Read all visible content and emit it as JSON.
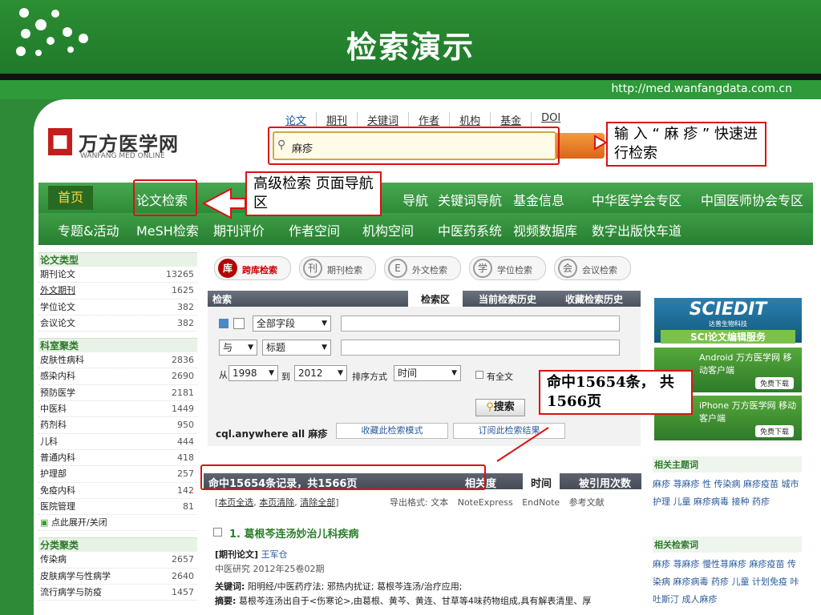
{
  "slide": {
    "title": "检索演示",
    "url": "http://med.wanfangdata.com.cn"
  },
  "logo": {
    "cn": "万方医学网",
    "en": "WANFANG MED ONLINE"
  },
  "search": {
    "tabs": [
      "论文",
      "期刊",
      "关键词",
      "作者",
      "机构",
      "基金",
      "DOI"
    ],
    "query": "麻疹"
  },
  "nav": {
    "row1": [
      "首页",
      "论文检索",
      "导航",
      "关键词导航",
      "基金信息",
      "中华医学会专区",
      "中国医师协会专区"
    ],
    "row2": [
      "专题&活动",
      "MeSH检索",
      "期刊评价",
      "作者空间",
      "机构空间",
      "中医药系统",
      "视频数据库",
      "数字出版快车道"
    ]
  },
  "sidebar": {
    "groups": [
      {
        "title": "论文类型",
        "items": [
          {
            "label": "期刊论文",
            "count": "13265"
          },
          {
            "label": "外文期刊",
            "count": "1625"
          },
          {
            "label": "学位论文",
            "count": "382"
          },
          {
            "label": "会议论文",
            "count": "382"
          }
        ]
      },
      {
        "title": "科室聚类",
        "items": [
          {
            "label": "皮肤性病科",
            "count": "2836"
          },
          {
            "label": "感染内科",
            "count": "2690"
          },
          {
            "label": "预防医学",
            "count": "2181"
          },
          {
            "label": "中医科",
            "count": "1449"
          },
          {
            "label": "药剂科",
            "count": "950"
          },
          {
            "label": "儿科",
            "count": "444"
          },
          {
            "label": "普通内科",
            "count": "418"
          },
          {
            "label": "护理部",
            "count": "257"
          },
          {
            "label": "免疫内科",
            "count": "142"
          },
          {
            "label": "医院管理",
            "count": "81"
          }
        ],
        "toggle": "点此展开/关闭"
      },
      {
        "title": "分类聚类",
        "items": [
          {
            "label": "传染病",
            "count": "2657"
          },
          {
            "label": "皮肤病学与性病学",
            "count": "2640"
          },
          {
            "label": "流行病学与防疫",
            "count": "1457"
          }
        ]
      }
    ]
  },
  "libtabs": [
    "跨库检索",
    "期刊检索",
    "外文检索",
    "学位检索",
    "会议检索"
  ],
  "searchbar": {
    "title": "检索",
    "tabs": [
      "检索区",
      "当前检索历史",
      "收藏检索历史"
    ]
  },
  "form": {
    "field1": "全部字段",
    "op": "与",
    "field2": "标题",
    "from_label": "从",
    "from": "1998",
    "to_label": "到",
    "to": "2012",
    "sort_label": "排序方式",
    "sort": "时间",
    "fulltext": "有全文",
    "search_btn": "搜索",
    "expr": "cql.anywhere all 麻疹",
    "save_mode": "收藏此检索模式",
    "subscribe": "订阅此检索结果"
  },
  "results": {
    "summary": "命中15654条记录，共1566页",
    "sort": [
      "相关度",
      "时间",
      "被引用次数"
    ],
    "actions": [
      "本页全选",
      "本页清除",
      "清除全部"
    ],
    "export_label": "导出格式:",
    "formats": [
      "文本",
      "NoteExpress",
      "EndNote",
      "参考文献"
    ],
    "item_title": "1. 葛根芩连汤妙治儿科疾病",
    "item_type": "[期刊论文]",
    "item_author": "王军仓",
    "item_source": "中医研究 2012年25卷02期",
    "keywords_label": "关键词:",
    "keywords": "阳明经/中医药疗法; 邪热内扰证; 葛根芩连汤/治疗应用;",
    "abstract_label": "摘要:",
    "abstract": "葛根芩连汤出自于<伤寒论>,由葛根、黄芩、黄连、甘草等4味药物组成,具有解表清里、厚"
  },
  "right": {
    "sciedit": "SCIEDIT",
    "sciedit_sub": "达普生物科技",
    "sciedit_banner": "SCI论文编辑服务",
    "android": "Android 万方医学网 移动客户端",
    "iphone": "iPhone 万方医学网 移动客户端",
    "download": "免费下载",
    "related_topics_title": "相关主题词",
    "related_topics": "麻疹 荨麻疹 性 传染病 麻疹疫苗 城市 护理 儿童 麻疹病毒 接种 药疹",
    "related_search_title": "相关检索词",
    "related_search": "麻疹 荨麻疹 慢性荨麻疹 麻疹疫苗 传染病 麻疹病毒 药疹 儿童 计划免疫 咔吐斯汀 成人麻疹"
  },
  "callouts": {
    "c1": "输 入 “ 麻 疹 ” 快速进行检索",
    "c2": "高级检索 页面导航区",
    "c3": "命中15654条， 共1566页"
  }
}
